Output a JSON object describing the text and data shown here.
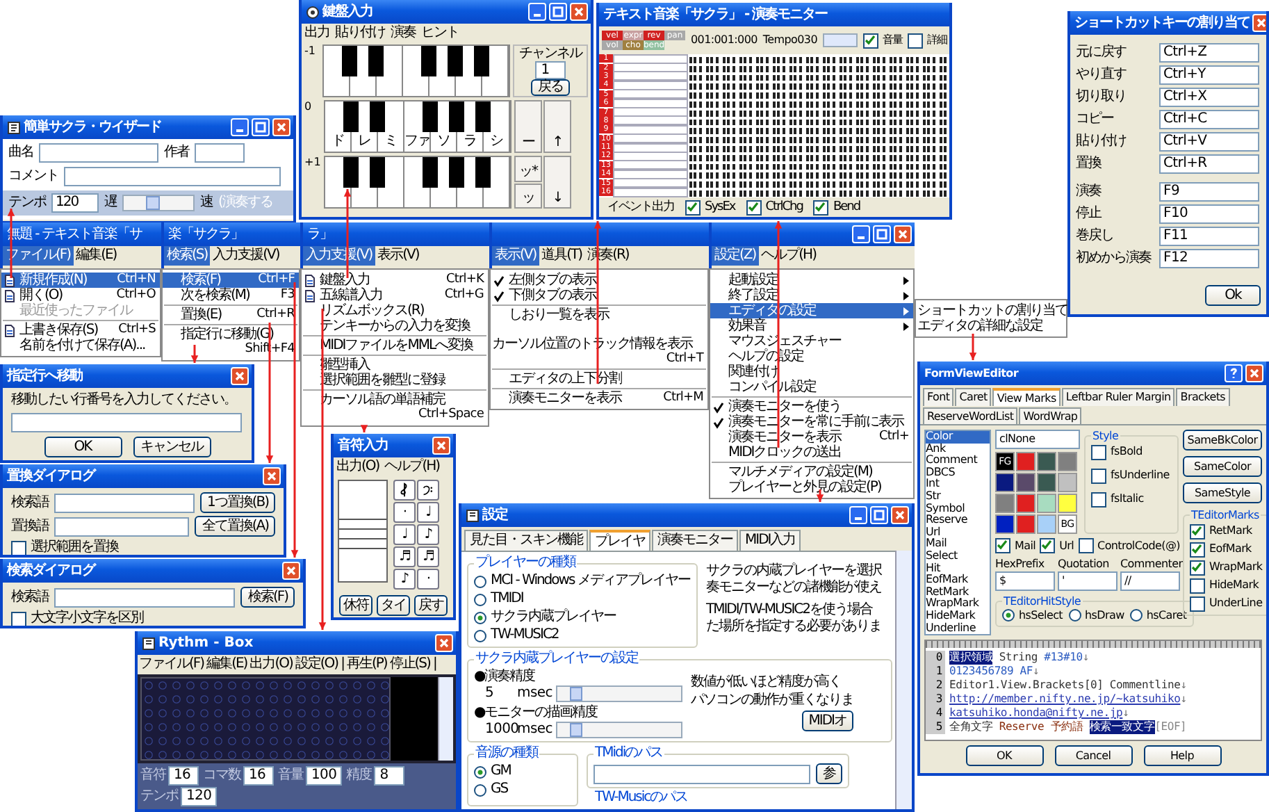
{
  "wizard": {
    "title": "簡単サクラ・ウイザード",
    "song_label": "曲名",
    "author_label": "作者",
    "comment_label": "コメント",
    "tempo_label": "テンポ",
    "tempo_value": "120",
    "slow_label": "遅",
    "fast_label": "速",
    "tempo_slider": {
      "level": 0.4
    },
    "hint": "(演奏する"
  },
  "keyboard": {
    "title": "鍵盤入力",
    "menu": [
      "出力",
      "貼り付け",
      "演奏",
      "ヒント"
    ],
    "channel_label": "チャンネル",
    "channel": "1",
    "back": "戻る",
    "rows": [
      {
        "octave": "-1"
      },
      {
        "octave": "0",
        "notes": [
          "ド",
          "レ",
          "ミ",
          "ファ",
          "ソ",
          "ラ",
          "シ"
        ],
        "side": [
          "ー",
          "↑"
        ]
      },
      {
        "octave": "+1",
        "side": [
          "ッ*",
          "ッ",
          "↓"
        ]
      }
    ]
  },
  "monitor": {
    "title": "テキスト音楽「サクラ」 - 演奏モニター",
    "params": [
      {
        "label": "vel",
        "color": "#d02020"
      },
      {
        "label": "expr",
        "color": "#c8a0a0"
      },
      {
        "label": "rev",
        "color": "#d02020"
      },
      {
        "label": "pan",
        "color": "#a8a8a8"
      },
      {
        "label": "vol",
        "color": "#a8a8a8"
      },
      {
        "label": "cho",
        "color": "#a08040"
      },
      {
        "label": "bend",
        "color": "#90c0a0"
      }
    ],
    "position": "001:001:000",
    "tempo": "Tempo030",
    "options": [
      {
        "label": "音量",
        "checked": true
      },
      {
        "label": "詳細",
        "checked": false
      }
    ],
    "tracks": [
      "1",
      "2",
      "3",
      "4",
      "5",
      "6",
      "7",
      "8",
      "9",
      "10",
      "11",
      "12",
      "13",
      "14",
      "15",
      "16"
    ],
    "event_label": "イベント出力",
    "events": [
      {
        "label": "SysEx",
        "checked": true
      },
      {
        "label": "CtrlChg",
        "checked": true
      },
      {
        "label": "Bend",
        "checked": true
      }
    ]
  },
  "main_window": {
    "panes": [
      {
        "title": "無題 - テキスト音楽「サ",
        "menu": [
          {
            "label": "ファイル(F)",
            "selected": true
          },
          {
            "label": "編集(E)",
            "selected": false
          }
        ],
        "items": [
          {
            "kind": "icon",
            "label": "新規作成(N)",
            "shortcut": "Ctrl+N",
            "selected": true,
            "disabled": false
          },
          {
            "kind": "icon",
            "label": "開く(O)",
            "shortcut": "Ctrl+O",
            "selected": false,
            "disabled": false
          },
          {
            "kind": "plain",
            "label": "最近使ったファイル",
            "selected": false,
            "disabled": true
          },
          {
            "kind": "separator"
          },
          {
            "kind": "icon",
            "label": "上書き保存(S)",
            "shortcut": "Ctrl+S",
            "selected": false,
            "disabled": false
          },
          {
            "kind": "plain",
            "label": "名前を付けて保存(A)...",
            "selected": false,
            "disabled": false
          }
        ]
      },
      {
        "title": "楽「サクラ」",
        "menu": [
          {
            "label": "検索(S)",
            "selected": true
          },
          {
            "label": "入力支援(V)",
            "selected": false
          }
        ],
        "items": [
          {
            "kind": "plain",
            "label": "検索(F)",
            "shortcut": "Ctrl+F",
            "selected": true
          },
          {
            "kind": "plain",
            "label": "次を検索(M)",
            "shortcut": "F3",
            "selected": false
          },
          {
            "kind": "separator"
          },
          {
            "kind": "plain",
            "label": "置換(E)",
            "shortcut": "Ctrl+R",
            "selected": false
          },
          {
            "kind": "separator"
          },
          {
            "kind": "plain",
            "label": "指定行に移動(G)",
            "shortcut": "Shift+F4",
            "selected": false
          }
        ]
      },
      {
        "title": "ラ」",
        "menu": [
          {
            "label": "入力支援(V)",
            "selected": true
          },
          {
            "label": "表示(V)",
            "selected": false
          }
        ],
        "items": [
          {
            "kind": "icon",
            "label": "鍵盤入力",
            "shortcut": "Ctrl+K",
            "selected": false
          },
          {
            "kind": "icon",
            "label": "五線譜入力",
            "shortcut": "Ctrl+G",
            "selected": false
          },
          {
            "kind": "plain",
            "label": "リズムボックス(R)",
            "selected": false
          },
          {
            "kind": "plain",
            "label": "テンキーからの入力を変換",
            "selected": false
          },
          {
            "kind": "separator"
          },
          {
            "kind": "plain",
            "label": "MIDIファイルをMMLへ変換",
            "selected": false
          },
          {
            "kind": "separator"
          },
          {
            "kind": "plain",
            "label": "雛型挿入",
            "selected": false
          },
          {
            "kind": "plain",
            "label": "選択範囲を雛型に登録",
            "selected": false
          },
          {
            "kind": "separator"
          },
          {
            "kind": "plain",
            "label": "カーソル語の単語補完",
            "shortcut": "Ctrl+Space",
            "selected": false
          }
        ]
      },
      {
        "menu": [
          {
            "label": "表示(V)",
            "selected": true
          },
          {
            "label": "道具(T)",
            "selected": false
          },
          {
            "label": "演奏(R)",
            "selected": false
          }
        ],
        "items": [
          {
            "kind": "check",
            "label": "左側タブの表示",
            "checked": true,
            "selected": false
          },
          {
            "kind": "check",
            "label": "下側タブの表示",
            "checked": true,
            "selected": false
          },
          {
            "kind": "separator"
          },
          {
            "kind": "check",
            "label": "しおり一覧を表示",
            "checked": false,
            "selected": false
          },
          {
            "kind": "check",
            "label": "カーソル位置のトラック情報を表示",
            "shortcut": "Ctrl+T",
            "checked": false,
            "selected": false
          },
          {
            "kind": "separator"
          },
          {
            "kind": "check",
            "label": "エディタの上下分割",
            "checked": false,
            "selected": false
          },
          {
            "kind": "separator"
          },
          {
            "kind": "check",
            "label": "演奏モニターを表示",
            "shortcut": "Ctrl+M",
            "checked": false,
            "selected": false
          }
        ]
      },
      {
        "menu": [
          {
            "label": "設定(Z)",
            "selected": true
          },
          {
            "label": "ヘルプ(H)",
            "selected": false
          }
        ],
        "items": [
          {
            "kind": "submenu",
            "label": "起動設定",
            "checked": false,
            "selected": false
          },
          {
            "kind": "submenu",
            "label": "終了設定",
            "checked": false,
            "selected": false
          },
          {
            "kind": "submenu",
            "label": "エディタの設定",
            "checked": false,
            "selected": true
          },
          {
            "kind": "submenu",
            "label": "効果音",
            "checked": false,
            "selected": false
          },
          {
            "kind": "check",
            "label": "マウスジェスチャー",
            "checked": false,
            "selected": false
          },
          {
            "kind": "check",
            "label": "ヘルプの設定",
            "checked": false,
            "selected": false
          },
          {
            "kind": "check",
            "label": "関連付け",
            "checked": false,
            "selected": false
          },
          {
            "kind": "check",
            "label": "コンパイル設定",
            "checked": false,
            "selected": false
          },
          {
            "kind": "separator"
          },
          {
            "kind": "check",
            "label": "演奏モニターを使う",
            "checked": true,
            "selected": false
          },
          {
            "kind": "check",
            "label": "演奏モニターを常に手前に表示",
            "checked": true,
            "selected": false
          },
          {
            "kind": "check",
            "label": "演奏モニターを表示",
            "shortcut": "Ctrl+",
            "checked": false,
            "selected": false
          },
          {
            "kind": "check",
            "label": "MIDIクロックの送出",
            "checked": false,
            "selected": false
          },
          {
            "kind": "separator"
          },
          {
            "kind": "check",
            "label": "マルチメディアの設定(M)",
            "checked": false,
            "selected": false
          },
          {
            "kind": "check",
            "label": "プレイヤーと外見の設定(P)",
            "checked": false,
            "selected": false
          }
        ]
      }
    ]
  },
  "submenu": [
    {
      "label": "ショートカットの割り当て",
      "selected": false
    },
    {
      "label": "エディタの詳細な設定",
      "selected": false
    }
  ],
  "shortcuts": {
    "title": "ショートカットキーの割り当て",
    "groups": [
      [
        {
          "label": "元に戻す",
          "value": "Ctrl+Z"
        },
        {
          "label": "やり直す",
          "value": "Ctrl+Y"
        },
        {
          "label": "切り取り",
          "value": "Ctrl+X"
        },
        {
          "label": "コピー",
          "value": "Ctrl+C"
        },
        {
          "label": "貼り付け",
          "value": "Ctrl+V"
        },
        {
          "label": "置換",
          "value": "Ctrl+R"
        }
      ],
      [
        {
          "label": "演奏",
          "value": "F9"
        },
        {
          "label": "停止",
          "value": "F10"
        },
        {
          "label": "巻戻し",
          "value": "F11"
        },
        {
          "label": "初めから演奏",
          "value": "F12"
        }
      ]
    ],
    "button": "Ok"
  },
  "goto_dialog": {
    "title": "指定行へ移動",
    "prompt": "移動したい行番号を入力してください。",
    "buttons": [
      "OK",
      "キャンセル"
    ]
  },
  "replace_dialog": {
    "title": "置換ダイアログ",
    "find_label": "検索語",
    "replace_label": "置換語",
    "buttons": [
      "1つ置換(B)",
      "全て置換(A)"
    ],
    "option": {
      "label": "選択範囲を置換",
      "checked": false
    }
  },
  "find_dialog": {
    "title": "検索ダイアログ",
    "find_label": "検索語",
    "button": "検索(F)",
    "option": {
      "label": "大文字小文字を区別",
      "checked": false
    }
  },
  "note_input": {
    "title": "音符入力",
    "menu": [
      "出力(O)",
      "ヘルプ(H)"
    ],
    "note_buttons": [
      {
        "kind": "treble"
      },
      {
        "kind": "bass"
      },
      {
        "kind": "glyph",
        "text": "·"
      },
      {
        "kind": "glyph",
        "text": "♩"
      },
      {
        "kind": "glyph",
        "text": "♩"
      },
      {
        "kind": "glyph",
        "text": "♪"
      },
      {
        "kind": "glyph",
        "text": "♬"
      },
      {
        "kind": "glyph",
        "text": "♬"
      },
      {
        "kind": "glyph",
        "text": "♪"
      },
      {
        "kind": "glyph",
        "text": "·"
      }
    ],
    "buttons": [
      "休符",
      "タイ",
      "戻す"
    ]
  },
  "rhythm_box": {
    "title": "Rythm - Box",
    "menu": [
      "ファイル(F)",
      "編集(E)",
      "出力(O)",
      "設定(O)",
      "|",
      "再生(P)",
      "停止(S)",
      "|"
    ],
    "spinners": [
      {
        "label": "音符",
        "value": "16"
      },
      {
        "label": "コマ数",
        "value": "16"
      },
      {
        "label": "音量",
        "value": "100"
      },
      {
        "label": "精度",
        "value": "8"
      },
      {
        "label": "テンポ",
        "value": "120"
      }
    ]
  },
  "settings": {
    "title": "設定",
    "tabs": [
      {
        "label": "見た目・スキン機能",
        "selected": false
      },
      {
        "label": "プレイヤ",
        "selected": true
      },
      {
        "label": "演奏モニター",
        "selected": false
      },
      {
        "label": "MIDI入力",
        "selected": false
      }
    ],
    "player_type": {
      "title": "プレイヤーの種類",
      "options": [
        {
          "label": "MCI - Windows メディアプレイヤー",
          "selected": false
        },
        {
          "label": "TMIDI",
          "selected": false
        },
        {
          "label": "サクラ内蔵プレイヤー",
          "selected": true
        },
        {
          "label": "TW-MUSIC2",
          "selected": false
        }
      ],
      "notes": [
        "サクラの内蔵プレイヤーを選択",
        "奏モニターなどの諸機能が使え",
        "TMIDI/TW-MUSIC2を使う場合",
        "た場所を指定する必要がありま"
      ]
    },
    "builtin": {
      "title": "サクラ内蔵プレイヤーの設定",
      "sliders": [
        {
          "label": "●演奏精度",
          "value": "5",
          "unit": "msec",
          "level": 0.1
        },
        {
          "label": "●モニターの描画精度",
          "value": "1000",
          "unit": "msec",
          "level": 0.1
        }
      ],
      "notes": [
        "数値が低いほど精度が高く",
        "パソコンの動作が重くなりま"
      ],
      "button": "MIDIオ"
    },
    "sound_source": {
      "title": "音源の種類",
      "options": [
        {
          "label": "GM",
          "selected": true
        },
        {
          "label": "GS",
          "selected": false
        }
      ]
    },
    "tmidi_path": {
      "title": "TMidiのパス",
      "button": "参"
    },
    "twmusic_path": {
      "title": "TW-Musicのパス"
    }
  },
  "form_view_editor": {
    "title": "FormViewEditor",
    "tabs": [
      {
        "label": "Font",
        "selected": false
      },
      {
        "label": "Caret",
        "selected": false
      },
      {
        "label": "View Marks",
        "selected": true
      },
      {
        "label": "Leftbar Ruler Margin",
        "selected": false
      },
      {
        "label": "Brackets",
        "selected": false
      },
      {
        "label": "ReserveWordList",
        "selected": false
      },
      {
        "label": "WordWrap",
        "selected": false
      }
    ],
    "elements": [
      {
        "label": "Color",
        "selected": true
      },
      {
        "label": "Ank",
        "selected": false
      },
      {
        "label": "Comment",
        "selected": false
      },
      {
        "label": "DBCS",
        "selected": false
      },
      {
        "label": "Int",
        "selected": false
      },
      {
        "label": "Str",
        "selected": false
      },
      {
        "label": "Symbol",
        "selected": false
      },
      {
        "label": "Reserve",
        "selected": false
      },
      {
        "label": "Url",
        "selected": false
      },
      {
        "label": "Mail",
        "selected": false
      },
      {
        "label": "Select",
        "selected": false
      },
      {
        "label": "Hit",
        "selected": false
      },
      {
        "label": "EofMark",
        "selected": false
      },
      {
        "label": "RetMark",
        "selected": false
      },
      {
        "label": "WrapMark",
        "selected": false
      },
      {
        "label": "HideMark",
        "selected": false
      },
      {
        "label": "Underline",
        "selected": false
      }
    ],
    "color_value": "clNone",
    "palette": [
      {
        "color": "#000000",
        "label": "FG"
      },
      {
        "color": "#e02020"
      },
      {
        "color": "#3a5a52"
      },
      {
        "color": "#808080"
      },
      {
        "color": "#0a1a80"
      },
      {
        "color": "#5a4a6a"
      },
      {
        "color": "#3a5a52"
      },
      {
        "color": "#c0c0c0"
      },
      {
        "color": "#808080"
      },
      {
        "color": "#e02020"
      },
      {
        "color": "#a8dcc0"
      },
      {
        "color": "#ffff40"
      },
      {
        "color": "#0020c0"
      },
      {
        "color": "#e02020"
      },
      {
        "color": "#a8d0f8"
      },
      {
        "color": "#ffffff",
        "label": "BG"
      }
    ],
    "style": {
      "title": "Style",
      "options": [
        {
          "label": "fsBold",
          "checked": false
        },
        {
          "label": "fsUnderline",
          "checked": false
        },
        {
          "label": "fsItalic",
          "checked": false
        }
      ]
    },
    "buttons": [
      "SameBkColor",
      "SameColor",
      "SameStyle"
    ],
    "flags": [
      {
        "label": "Mail",
        "checked": true
      },
      {
        "label": "Url",
        "checked": true
      },
      {
        "label": "ControlCode(@)",
        "checked": false
      }
    ],
    "fields": [
      {
        "label": "HexPrefix",
        "value": "$"
      },
      {
        "label": "Quotation",
        "value": "'"
      },
      {
        "label": "Commenter",
        "value": "//"
      }
    ],
    "hit_style": {
      "title": "TEditorHitStyle",
      "options": [
        {
          "label": "hsSelect",
          "selected": true
        },
        {
          "label": "hsDraw",
          "selected": false
        },
        {
          "label": "hsCaret",
          "selected": false
        }
      ]
    },
    "marks": {
      "title": "TEditorMarks",
      "options": [
        {
          "label": "RetMark",
          "checked": true
        },
        {
          "label": "EofMark",
          "checked": true
        },
        {
          "label": "WrapMark",
          "checked": true
        },
        {
          "label": "HideMark",
          "checked": false
        },
        {
          "label": "UnderLine",
          "checked": false
        }
      ]
    },
    "preview": [
      {
        "number": "0",
        "segments": [
          {
            "kind": "select",
            "text": "選択領域"
          },
          {
            "kind": "plain",
            "text": " String "
          },
          {
            "kind": "number",
            "text": "#13#10"
          },
          {
            "kind": "mark",
            "text": "↓"
          }
        ]
      },
      {
        "number": "1",
        "segments": [
          {
            "kind": "number",
            "text": "0123456789 AF"
          },
          {
            "kind": "mark",
            "text": "↓"
          }
        ]
      },
      {
        "number": "2",
        "segments": [
          {
            "kind": "plain",
            "text": "Editor1.View.Brackets[0] Commentline"
          },
          {
            "kind": "mark",
            "text": "↓"
          }
        ]
      },
      {
        "number": "3",
        "segments": [
          {
            "kind": "url",
            "text": "http://member.nifty.ne.jp/~katsuhiko"
          },
          {
            "kind": "mark",
            "text": "↓"
          }
        ]
      },
      {
        "number": "4",
        "segments": [
          {
            "kind": "url",
            "text": "katsuhiko.honda@nifty.ne.jp"
          },
          {
            "kind": "mark",
            "text": "↓"
          }
        ]
      },
      {
        "number": "5",
        "segments": [
          {
            "kind": "plain",
            "text": "全角文字 "
          },
          {
            "kind": "reserve",
            "text": "Reserve 予約語 "
          },
          {
            "kind": "hit",
            "text": "検索一致文字"
          },
          {
            "kind": "eof",
            "text": "[EOF]"
          }
        ]
      }
    ],
    "dialog_buttons": [
      "OK",
      "Cancel",
      "Help"
    ]
  }
}
